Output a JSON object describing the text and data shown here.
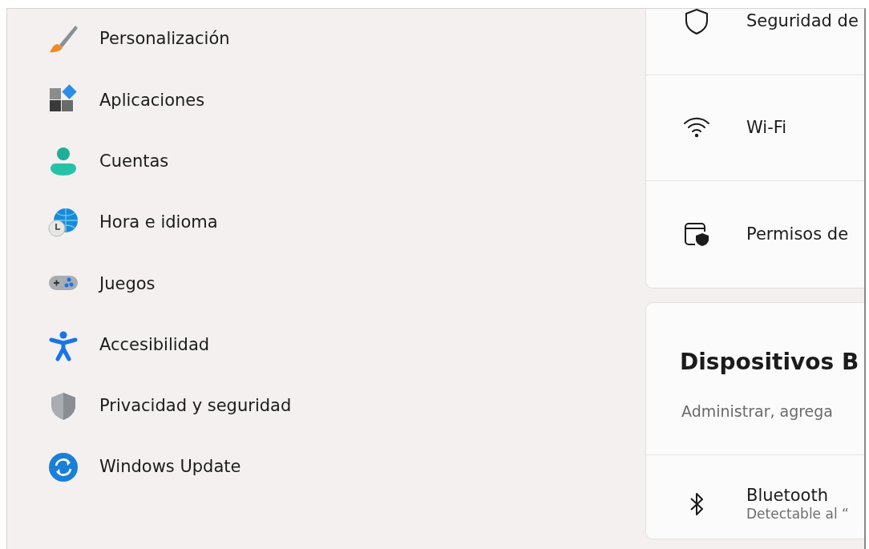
{
  "sidebar": {
    "items": [
      {
        "label": "Personalización"
      },
      {
        "label": "Aplicaciones"
      },
      {
        "label": "Cuentas"
      },
      {
        "label": "Hora e idioma"
      },
      {
        "label": "Juegos"
      },
      {
        "label": "Accesibilidad"
      },
      {
        "label": "Privacidad y seguridad"
      },
      {
        "label": "Windows Update"
      }
    ]
  },
  "privacy_card": {
    "rows": [
      {
        "kind": "shield",
        "label": "Seguridad de"
      },
      {
        "kind": "wifi",
        "label": "Wi-Fi"
      },
      {
        "kind": "permissions",
        "label": "Permisos de"
      }
    ]
  },
  "devices_card": {
    "title": "Dispositivos B",
    "subtitle": "Administrar, agrega",
    "rows": [
      {
        "kind": "bluetooth",
        "label": "Bluetooth",
        "description": "Detectable al “"
      }
    ]
  }
}
